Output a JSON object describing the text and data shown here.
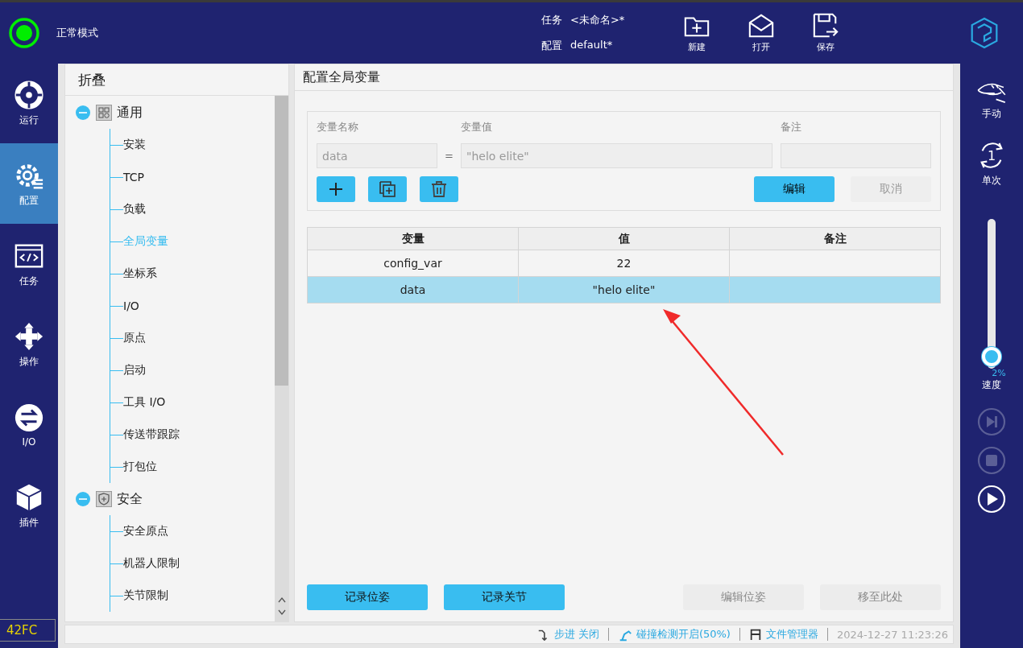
{
  "status": {
    "indicator_on": true,
    "mode": "正常模式"
  },
  "header": {
    "task_label": "任务",
    "task_value": "<未命名>*",
    "config_label": "配置",
    "config_value": "default*"
  },
  "toolbar": [
    {
      "label": "新建",
      "kind": "new"
    },
    {
      "label": "打开",
      "kind": "open"
    },
    {
      "label": "保存",
      "kind": "save"
    }
  ],
  "nav": [
    {
      "label": "运行",
      "kind": "run",
      "selected": false
    },
    {
      "label": "配置",
      "kind": "config",
      "selected": true
    },
    {
      "label": "任务",
      "kind": "task",
      "selected": false
    },
    {
      "label": "操作",
      "kind": "move",
      "selected": false
    },
    {
      "label": "I/O",
      "kind": "io",
      "selected": false
    },
    {
      "label": "插件",
      "kind": "plugin",
      "selected": false
    }
  ],
  "badge": "42FC",
  "tree": {
    "header": "折叠",
    "groups": [
      {
        "label": "通用",
        "kind": "general",
        "expanded": true,
        "children": [
          {
            "label": "安装",
            "selected": false
          },
          {
            "label": "TCP",
            "selected": false
          },
          {
            "label": "负载",
            "selected": false
          },
          {
            "label": "全局变量",
            "selected": true
          },
          {
            "label": "坐标系",
            "selected": false
          },
          {
            "label": "I/O",
            "selected": false
          },
          {
            "label": "原点",
            "selected": false
          },
          {
            "label": "启动",
            "selected": false
          },
          {
            "label": "工具 I/O",
            "selected": false
          },
          {
            "label": "传送带跟踪",
            "selected": false
          },
          {
            "label": "打包位",
            "selected": false
          }
        ]
      },
      {
        "label": "安全",
        "kind": "safety",
        "expanded": true,
        "children": [
          {
            "label": "安全原点",
            "selected": false
          },
          {
            "label": "机器人限制",
            "selected": false
          },
          {
            "label": "关节限制",
            "selected": false
          }
        ]
      }
    ]
  },
  "editor": {
    "title": "配置全局变量",
    "name_label": "变量名称",
    "value_label": "变量值",
    "note_label": "备注",
    "name_value": "data",
    "equals": "=",
    "value_value": "\"helo elite\"",
    "edit_button": "编辑",
    "cancel_button": "取消"
  },
  "table": {
    "columns": [
      "变量",
      "值",
      "备注"
    ],
    "rows": [
      {
        "name": "config_var",
        "value": "22",
        "selected": false
      },
      {
        "name": "data",
        "value": "\"helo elite\"",
        "selected": true
      }
    ]
  },
  "actions": [
    {
      "label": "记录位姿",
      "disabled": false
    },
    {
      "label": "记录关节",
      "disabled": false
    },
    {
      "label": "编辑位姿",
      "disabled": true
    },
    {
      "label": "移至此处",
      "disabled": true
    }
  ],
  "status_bar": {
    "step": "步进 关闭",
    "collision": "碰撞检测开启(50%)",
    "files": "文件管理器",
    "datetime": "2024-12-27 11:23:26"
  },
  "right": {
    "mode": "手动",
    "cycle": "单次",
    "cycle_number": "1",
    "speed": {
      "level": 0.02,
      "reading": "2%",
      "label": "速度"
    },
    "controls": [
      {
        "kind": "step",
        "disabled": true
      },
      {
        "kind": "stop",
        "disabled": true
      },
      {
        "kind": "play",
        "disabled": false
      }
    ]
  }
}
